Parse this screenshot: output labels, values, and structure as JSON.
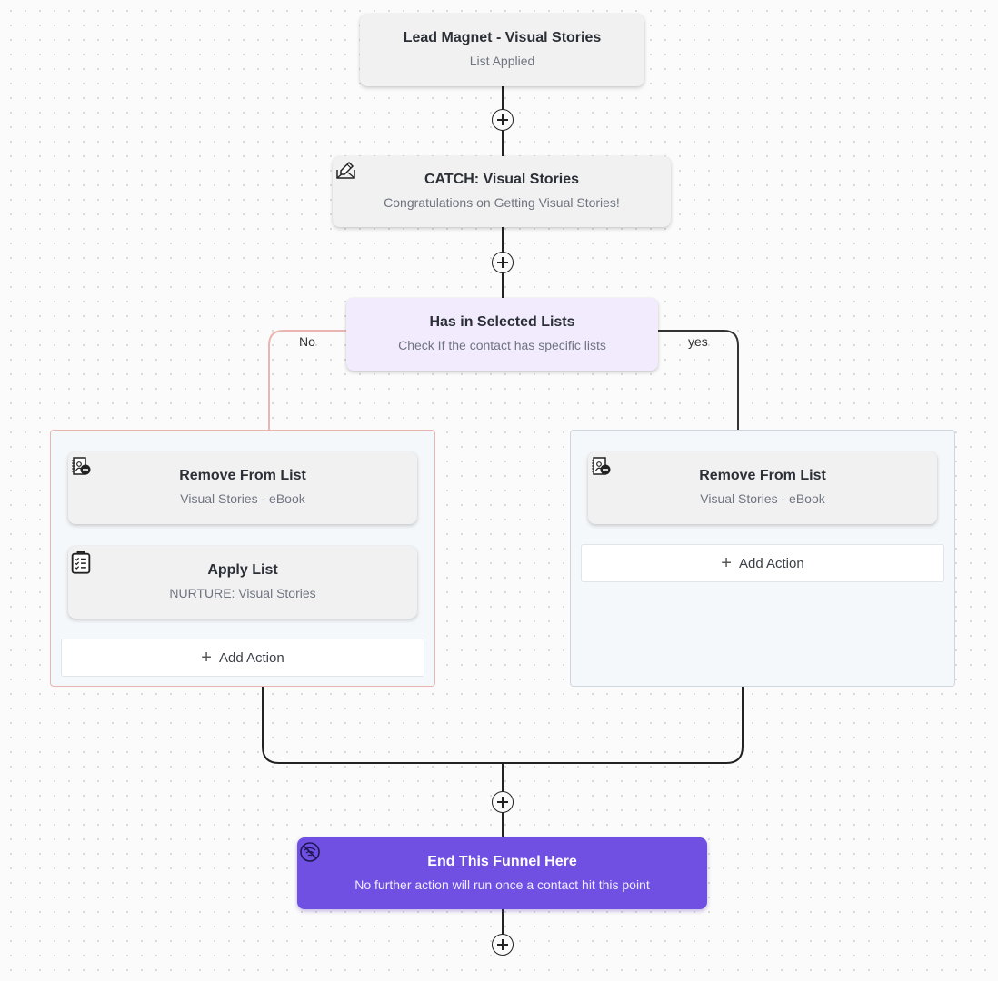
{
  "flow": {
    "trigger": {
      "title": "Lead Magnet - Visual Stories",
      "subtitle": "List Applied"
    },
    "email_step": {
      "icon": "email-edit-icon",
      "title": "CATCH: Visual Stories",
      "subtitle": "Congratulations on Getting Visual Stories!"
    },
    "condition": {
      "title": "Has in Selected Lists",
      "subtitle": "Check If the contact has specific lists",
      "no_label": "No",
      "yes_label": "yes"
    },
    "no_branch": {
      "actions": [
        {
          "icon": "remove-contact-list-icon",
          "title": "Remove From List",
          "subtitle": "Visual Stories - eBook"
        },
        {
          "icon": "clipboard-checklist-icon",
          "title": "Apply List",
          "subtitle": "NURTURE: Visual Stories"
        }
      ],
      "add_action_label": "Add Action"
    },
    "yes_branch": {
      "actions": [
        {
          "icon": "remove-contact-list-icon",
          "title": "Remove From List",
          "subtitle": "Visual Stories - eBook"
        }
      ],
      "add_action_label": "Add Action"
    },
    "end_step": {
      "icon": "no-entry-icon",
      "title": "End This Funnel Here",
      "subtitle": "No further action will run once a contact hit this point"
    }
  },
  "colors": {
    "end_node": "#6f50e3",
    "condition_node": "#f1ebfd",
    "no_branch_line": "#eab4b0",
    "yes_branch_line": "#333333",
    "connector": "#222222"
  }
}
